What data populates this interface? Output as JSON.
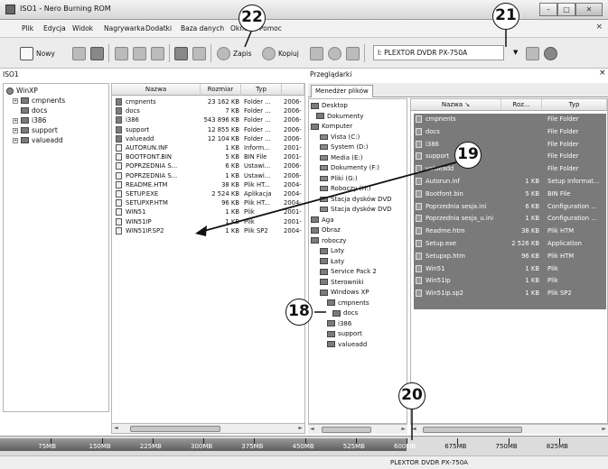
{
  "window": {
    "title": "ISO1 - Nero Burning ROM",
    "minimize": "–",
    "maximize": "□",
    "close": "✕"
  },
  "menu": {
    "items": [
      "Plik",
      "Edycja",
      "Widok",
      "Nagrywarka",
      "Dodatki",
      "Baza danych",
      "Okno",
      "Pomoc"
    ],
    "close": "×"
  },
  "toolbar": {
    "new_label": "Nowy",
    "burn_label": "Zapis",
    "copy_label": "Kopiuj",
    "recorder": "I: PLEXTOR DVDR   PX-750A"
  },
  "left_panel": {
    "header": "ISO1",
    "tree": [
      {
        "label": "WinXP"
      },
      {
        "label": "cmpnents"
      },
      {
        "label": "docs"
      },
      {
        "label": "i386"
      },
      {
        "label": "support"
      },
      {
        "label": "valueadd"
      }
    ]
  },
  "file_list": {
    "columns": [
      "Nazwa",
      "Rozmiar",
      "Typ"
    ],
    "rows": [
      {
        "name": "cmpnents",
        "size": "23 162 KB",
        "type": "Folder ...",
        "date": "2006-"
      },
      {
        "name": "docs",
        "size": "7 KB",
        "type": "Folder ...",
        "date": "2006-"
      },
      {
        "name": "i386",
        "size": "543 896 KB",
        "type": "Folder ...",
        "date": "2006-"
      },
      {
        "name": "support",
        "size": "12 855 KB",
        "type": "Folder ...",
        "date": "2006-"
      },
      {
        "name": "valueadd",
        "size": "12 104 KB",
        "type": "Folder ...",
        "date": "2006-"
      },
      {
        "name": "AUTORUN.INF",
        "size": "1 KB",
        "type": "Inform...",
        "date": "2001-"
      },
      {
        "name": "BOOTFONT.BIN",
        "size": "5 KB",
        "type": "BIN File",
        "date": "2001-"
      },
      {
        "name": "POPRZEDNIA S...",
        "size": "6 KB",
        "type": "Ustawi...",
        "date": "2006-"
      },
      {
        "name": "POPRZEDNIA S...",
        "size": "1 KB",
        "type": "Ustawi...",
        "date": "2006-"
      },
      {
        "name": "README.HTM",
        "size": "38 KB",
        "type": "Plik HT...",
        "date": "2004-"
      },
      {
        "name": "SETUP.EXE",
        "size": "2 524 KB",
        "type": "Aplikacja",
        "date": "2004-"
      },
      {
        "name": "SETUPXP.HTM",
        "size": "96 KB",
        "type": "Plik HT...",
        "date": "2004-"
      },
      {
        "name": "WIN51",
        "size": "1 KB",
        "type": "Plik",
        "date": "2001-"
      },
      {
        "name": "WIN51IP",
        "size": "1 KB",
        "type": "Plik",
        "date": "2001-"
      },
      {
        "name": "WIN51IP.SP2",
        "size": "1 KB",
        "type": "Plik SP2",
        "date": "2004-"
      }
    ]
  },
  "browser": {
    "header": "Przeglądarki",
    "close": "×",
    "tab": "Menedżer plików",
    "tree": [
      {
        "label": "Desktop"
      },
      {
        "label": "Dokumenty"
      },
      {
        "label": "Komputer"
      },
      {
        "label": "Vista (C:)"
      },
      {
        "label": "System (D:)"
      },
      {
        "label": "Media (E:)"
      },
      {
        "label": "Dokumenty (F:)"
      },
      {
        "label": "Pliki (G:)"
      },
      {
        "label": "Roboczy (H:)"
      },
      {
        "label": "Stacja dysków DVD"
      },
      {
        "label": "Stacja dysków DVD"
      },
      {
        "label": "Aga"
      },
      {
        "label": "Obraz"
      },
      {
        "label": "roboczy"
      },
      {
        "label": "Laty"
      },
      {
        "label": "Łaty"
      },
      {
        "label": "Service Pack 2"
      },
      {
        "label": "Sterowniki"
      },
      {
        "label": "Windows XP"
      },
      {
        "label": "cmpnents"
      },
      {
        "label": "docs"
      },
      {
        "label": "i386"
      },
      {
        "label": "support"
      },
      {
        "label": "valueadd"
      }
    ],
    "list_columns": [
      "Nazwa",
      "Roz...",
      "Typ"
    ],
    "list_rows": [
      {
        "name": "cmpnents",
        "size": "",
        "type": "File Folder"
      },
      {
        "name": "docs",
        "size": "",
        "type": "File Folder"
      },
      {
        "name": "i386",
        "size": "",
        "type": "File Folder"
      },
      {
        "name": "support",
        "size": "",
        "type": "File Folder"
      },
      {
        "name": "valueadd",
        "size": "",
        "type": "File Folder"
      },
      {
        "name": "Autorun.inf",
        "size": "1 KB",
        "type": "Setup Informat..."
      },
      {
        "name": "Bootfont.bin",
        "size": "5 KB",
        "type": "BIN File"
      },
      {
        "name": "Poprzednia sesja.ini",
        "size": "6 KB",
        "type": "Configuration ..."
      },
      {
        "name": "Poprzednia sesja_u.ini",
        "size": "1 KB",
        "type": "Configuration ..."
      },
      {
        "name": "Readme.htm",
        "size": "38 KB",
        "type": "Plik HTM"
      },
      {
        "name": "Setup.exe",
        "size": "2 526 KB",
        "type": "Application"
      },
      {
        "name": "Setupxp.htm",
        "size": "96 KB",
        "type": "Plik HTM"
      },
      {
        "name": "Win51",
        "size": "1 KB",
        "type": "Plik"
      },
      {
        "name": "Win51ip",
        "size": "1 KB",
        "type": "Plik"
      },
      {
        "name": "Win51ip.sp2",
        "size": "1 KB",
        "type": "Plik SP2"
      }
    ]
  },
  "capacity_ruler": {
    "labels": [
      "75MB",
      "150MB",
      "225MB",
      "300MB",
      "375MB",
      "450MB",
      "525MB",
      "600MB",
      "675MB",
      "750MB",
      "825MB"
    ],
    "used_mb": 600
  },
  "status": {
    "recorder": "PLEXTOR  DVDR  PX-750A"
  },
  "callouts": [
    "22",
    "21",
    "19",
    "18",
    "20"
  ]
}
